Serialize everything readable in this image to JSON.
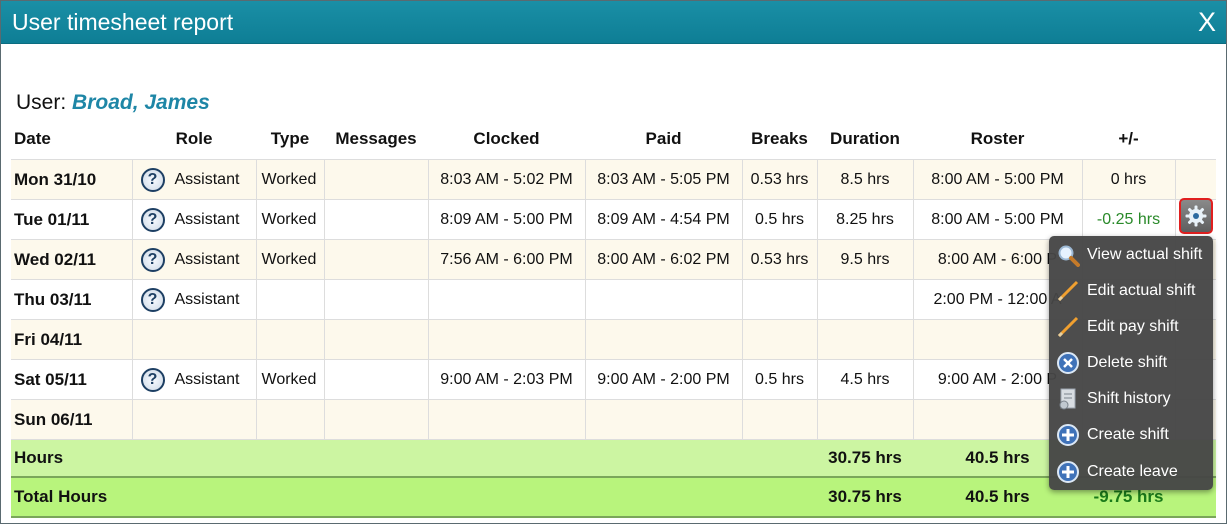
{
  "dialog": {
    "title": "User timesheet report",
    "close_glyph": "X",
    "user_label": "User:",
    "user_name": "Broad, James"
  },
  "table": {
    "columns": [
      "Date",
      "Role",
      "Type",
      "Messages",
      "Clocked",
      "Paid",
      "Breaks",
      "Duration",
      "Roster",
      "+/-"
    ],
    "rows": [
      {
        "date": "Mon 31/10",
        "role": "Assistant",
        "type": "Worked",
        "messages": "",
        "clocked": "8:03 AM - 5:02 PM",
        "paid": "8:03 AM - 5:05 PM",
        "breaks": "0.53 hrs",
        "duration": "8.5 hrs",
        "roster": "8:00 AM - 5:00 PM",
        "diff": "0 hrs"
      },
      {
        "date": "Tue 01/11",
        "role": "Assistant",
        "type": "Worked",
        "messages": "",
        "clocked": "8:09 AM - 5:00 PM",
        "paid": "8:09 AM - 4:54 PM",
        "breaks": "0.5 hrs",
        "duration": "8.25 hrs",
        "roster": "8:00 AM - 5:00 PM",
        "diff": "-0.25 hrs"
      },
      {
        "date": "Wed 02/11",
        "role": "Assistant",
        "type": "Worked",
        "messages": "",
        "clocked": "7:56 AM - 6:00 PM",
        "paid": "8:00 AM - 6:02 PM",
        "breaks": "0.53 hrs",
        "duration": "9.5 hrs",
        "roster": "8:00 AM - 6:00 P",
        "diff": ""
      },
      {
        "date": "Thu 03/11",
        "role": "Assistant",
        "type": "",
        "messages": "",
        "clocked": "",
        "paid": "",
        "breaks": "",
        "duration": "",
        "roster": "2:00 PM - 12:00 A",
        "diff": ""
      },
      {
        "date": "Fri 04/11",
        "role": "",
        "type": "",
        "messages": "",
        "clocked": "",
        "paid": "",
        "breaks": "",
        "duration": "",
        "roster": "",
        "diff": ""
      },
      {
        "date": "Sat 05/11",
        "role": "Assistant",
        "type": "Worked",
        "messages": "",
        "clocked": "9:00 AM - 2:03 PM",
        "paid": "9:00 AM - 2:00 PM",
        "breaks": "0.5 hrs",
        "duration": "4.5 hrs",
        "roster": "9:00 AM - 2:00 P",
        "diff": ""
      },
      {
        "date": "Sun 06/11",
        "role": "",
        "type": "",
        "messages": "",
        "clocked": "",
        "paid": "",
        "breaks": "",
        "duration": "",
        "roster": "",
        "diff": ""
      }
    ],
    "summary": {
      "hours_label": "Hours",
      "hours_duration": "30.75 hrs",
      "hours_roster": "40.5 hrs",
      "total_label": "Total Hours",
      "total_duration": "30.75 hrs",
      "total_roster": "40.5 hrs",
      "total_diff": "-9.75 hrs"
    }
  },
  "context_menu": {
    "items": [
      {
        "label": "View actual shift",
        "icon": "magnifier-icon"
      },
      {
        "label": "Edit actual shift",
        "icon": "pencil-icon"
      },
      {
        "label": "Edit pay shift",
        "icon": "pencil-icon"
      },
      {
        "label": "Delete shift",
        "icon": "delete-icon"
      },
      {
        "label": "Shift history",
        "icon": "history-icon"
      },
      {
        "label": "Create shift",
        "icon": "plus-icon"
      },
      {
        "label": "Create leave",
        "icon": "plus-icon"
      }
    ]
  },
  "colors": {
    "titlebar": "#1a8fa6",
    "user_name": "#1e86a6",
    "row_alt": "#fdf9ec",
    "hours_row": "#ccf5a2",
    "total_row": "#b8f47c",
    "negative": "#2a8a2a",
    "gear_highlight": "#e01f1f"
  }
}
